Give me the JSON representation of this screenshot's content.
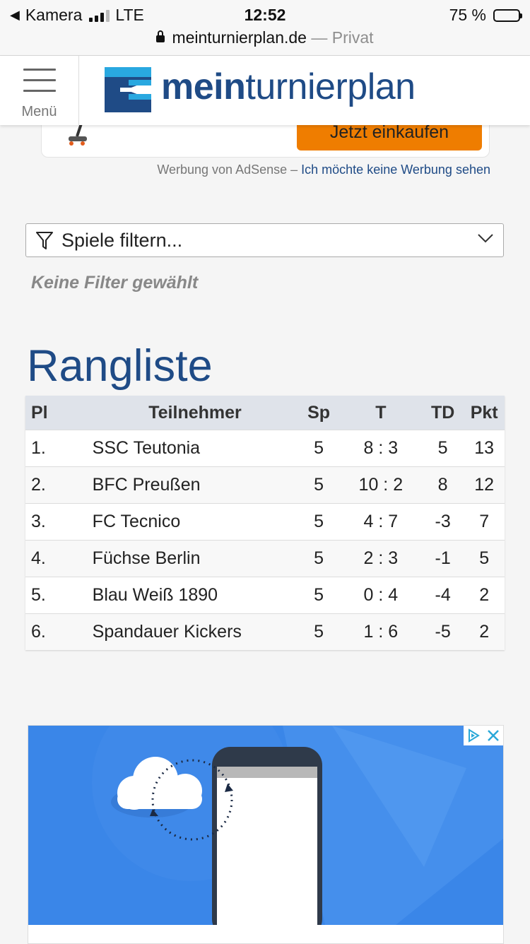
{
  "status_bar": {
    "back_app": "Kamera",
    "network": "LTE",
    "time": "12:52",
    "battery": "75 %",
    "battery_level": 0.75
  },
  "url_bar": {
    "domain": "meinturnierplan.de",
    "mode": "— Privat"
  },
  "header": {
    "menu_label": "Menü",
    "logo_bold": "mein",
    "logo_rest": "turnierplan"
  },
  "ad_top": {
    "cta_label": "Jetzt einkaufen"
  },
  "adsense": {
    "prefix": "Werbung von AdSense –",
    "link": "Ich möchte keine Werbung sehen"
  },
  "filter": {
    "placeholder": "Spiele filtern...",
    "status": "Keine Filter gewählt"
  },
  "ranking": {
    "title": "Rangliste",
    "columns": [
      "Pl",
      "Teilnehmer",
      "Sp",
      "T",
      "TD",
      "Pkt"
    ],
    "rows": [
      {
        "pl": "1.",
        "team": "SSC Teutonia",
        "sp": "5",
        "t": "8 : 3",
        "td": "5",
        "pkt": "13"
      },
      {
        "pl": "2.",
        "team": "BFC Preußen",
        "sp": "5",
        "t": "10 : 2",
        "td": "8",
        "pkt": "12"
      },
      {
        "pl": "3.",
        "team": "FC Tecnico",
        "sp": "5",
        "t": "4 : 7",
        "td": "-3",
        "pkt": "7"
      },
      {
        "pl": "4.",
        "team": "Füchse Berlin",
        "sp": "5",
        "t": "2 : 3",
        "td": "-1",
        "pkt": "5"
      },
      {
        "pl": "5.",
        "team": "Blau Weiß 1890",
        "sp": "5",
        "t": "0 : 4",
        "td": "-4",
        "pkt": "2"
      },
      {
        "pl": "6.",
        "team": "Spandauer Kickers",
        "sp": "5",
        "t": "1 : 6",
        "td": "-5",
        "pkt": "2"
      }
    ]
  },
  "colors": {
    "brand": "#1f4b86",
    "logo_cyan": "#29a8e0",
    "cta_orange": "#ef7d00",
    "ad_blue": "#3a86e8"
  }
}
